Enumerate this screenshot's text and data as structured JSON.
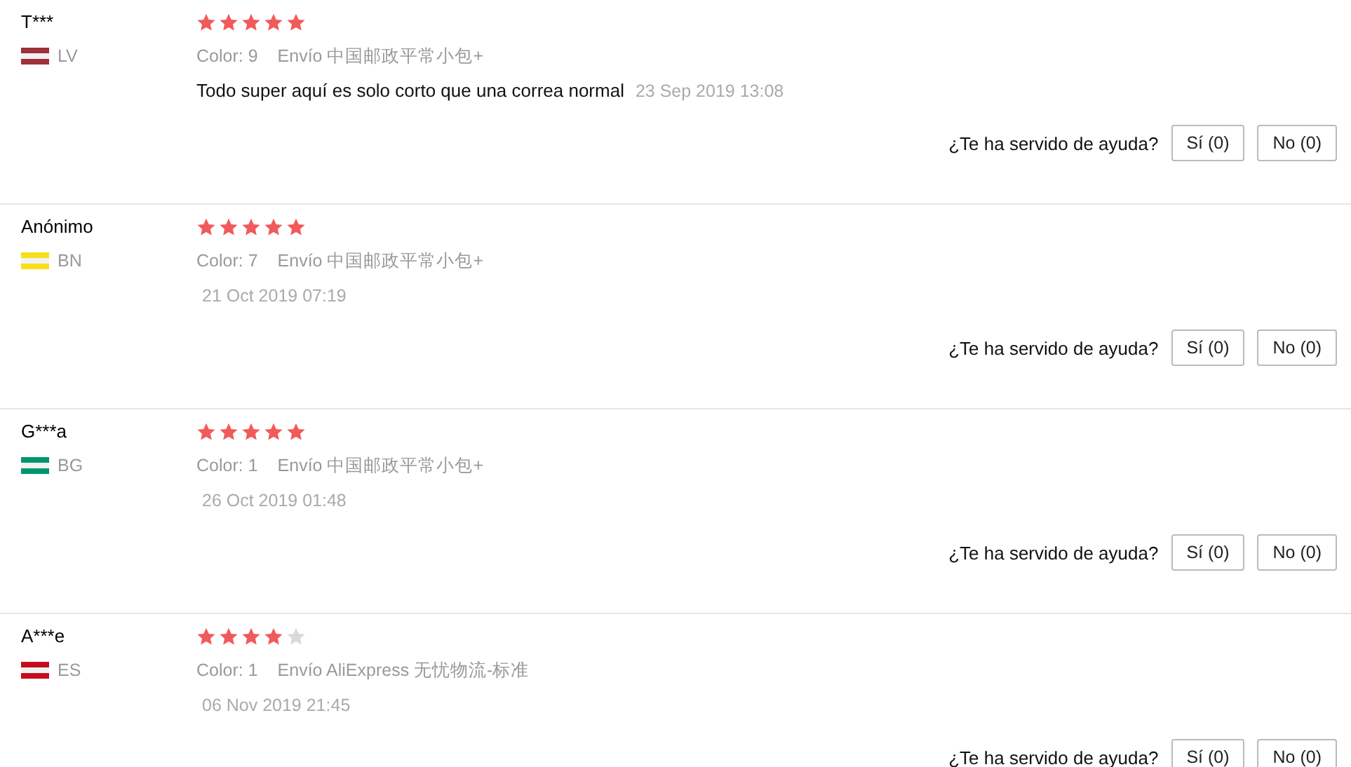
{
  "reviews": [
    {
      "user": "T***",
      "country": "LV",
      "color": "#9e3039",
      "stars": 5,
      "variant": "Color: 9",
      "shipping": "Envío 中国邮政平常小包+",
      "text": "Todo super aquí es solo corto que una correa normal",
      "date": "23 Sep 2019 13:08",
      "helpful": "¿Te ha servido de ayuda?",
      "yes": "Sí (0)",
      "no": "No (0)"
    },
    {
      "user": "Anónimo",
      "country": "BN",
      "color": "#f7e017",
      "stars": 5,
      "variant": "Color: 7",
      "shipping": "Envío 中国邮政平常小包+",
      "date": "21 Oct 2019 07:19",
      "helpful": "¿Te ha servido de ayuda?",
      "yes": "Sí (0)",
      "no": "No (0)"
    },
    {
      "user": "G***a",
      "country": "BG",
      "color": "#00966e",
      "stars": 5,
      "variant": "Color: 1",
      "shipping": "Envío 中国邮政平常小包+",
      "date": "26 Oct 2019 01:48",
      "helpful": "¿Te ha servido de ayuda?",
      "yes": "Sí (0)",
      "no": "No (0)"
    },
    {
      "user": "A***e",
      "country": "ES",
      "color": "#c60b1e",
      "stars": 4,
      "variant": "Color: 1",
      "shipping": "Envío AliExpress 无忧物流-标准",
      "date": "06 Nov 2019 21:45",
      "helpful": "¿Te ha servido de ayuda?",
      "yes": "Sí (0)",
      "no": "No (0)"
    }
  ]
}
